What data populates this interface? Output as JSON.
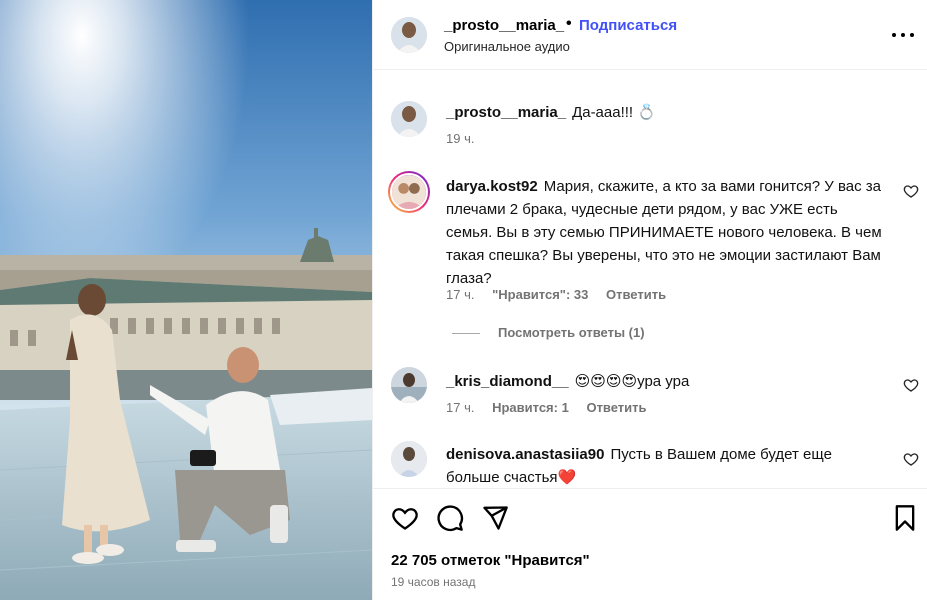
{
  "post": {
    "author": "_prosto__maria_",
    "separator": "•",
    "follow_label": "Подписаться",
    "audio": "Оригинальное аудио",
    "more_icon": "more-horizontal-icon"
  },
  "caption": {
    "username": "_prosto__maria_",
    "text": "Да-ааа!!! 💍",
    "time": "19 ч."
  },
  "comments": [
    {
      "username": "darya.kost92",
      "text": "Мария, скажите, а кто за вами гонится? У вас за плечами 2 брака, чудесные дети рядом, у вас УЖЕ есть семья. Вы в эту семью ПРИНИМАЕТЕ нового человека. В чем такая спешка? Вы уверены, что это не эмоции застилают Вам глаза?",
      "time": "17 ч.",
      "likes": "\"Нравится\": 33",
      "reply": "Ответить",
      "has_story_ring": true
    },
    {
      "username": "_kris_diamond__",
      "text": "😍😍😍😍ура ура",
      "time": "17 ч.",
      "likes": "Нравится: 1",
      "reply": "Ответить",
      "has_story_ring": false
    },
    {
      "username": "denisova.anastasiia90",
      "text": "Пусть в Вашем доме будет еще больше счастья❤️",
      "has_story_ring": false
    }
  ],
  "view_replies": "Посмотреть ответы (1)",
  "actions": {
    "icons": [
      "heart-icon",
      "comment-icon",
      "share-icon",
      "bookmark-icon"
    ],
    "likes_count": "22 705 отметок \"Нравится\"",
    "time_ago": "19 часов назад"
  },
  "colors": {
    "accent": "#4150f7",
    "muted": "#737373",
    "border": "#efefef",
    "story_ring_start": "#f9ce34",
    "story_ring_end": "#ee2a7b"
  }
}
